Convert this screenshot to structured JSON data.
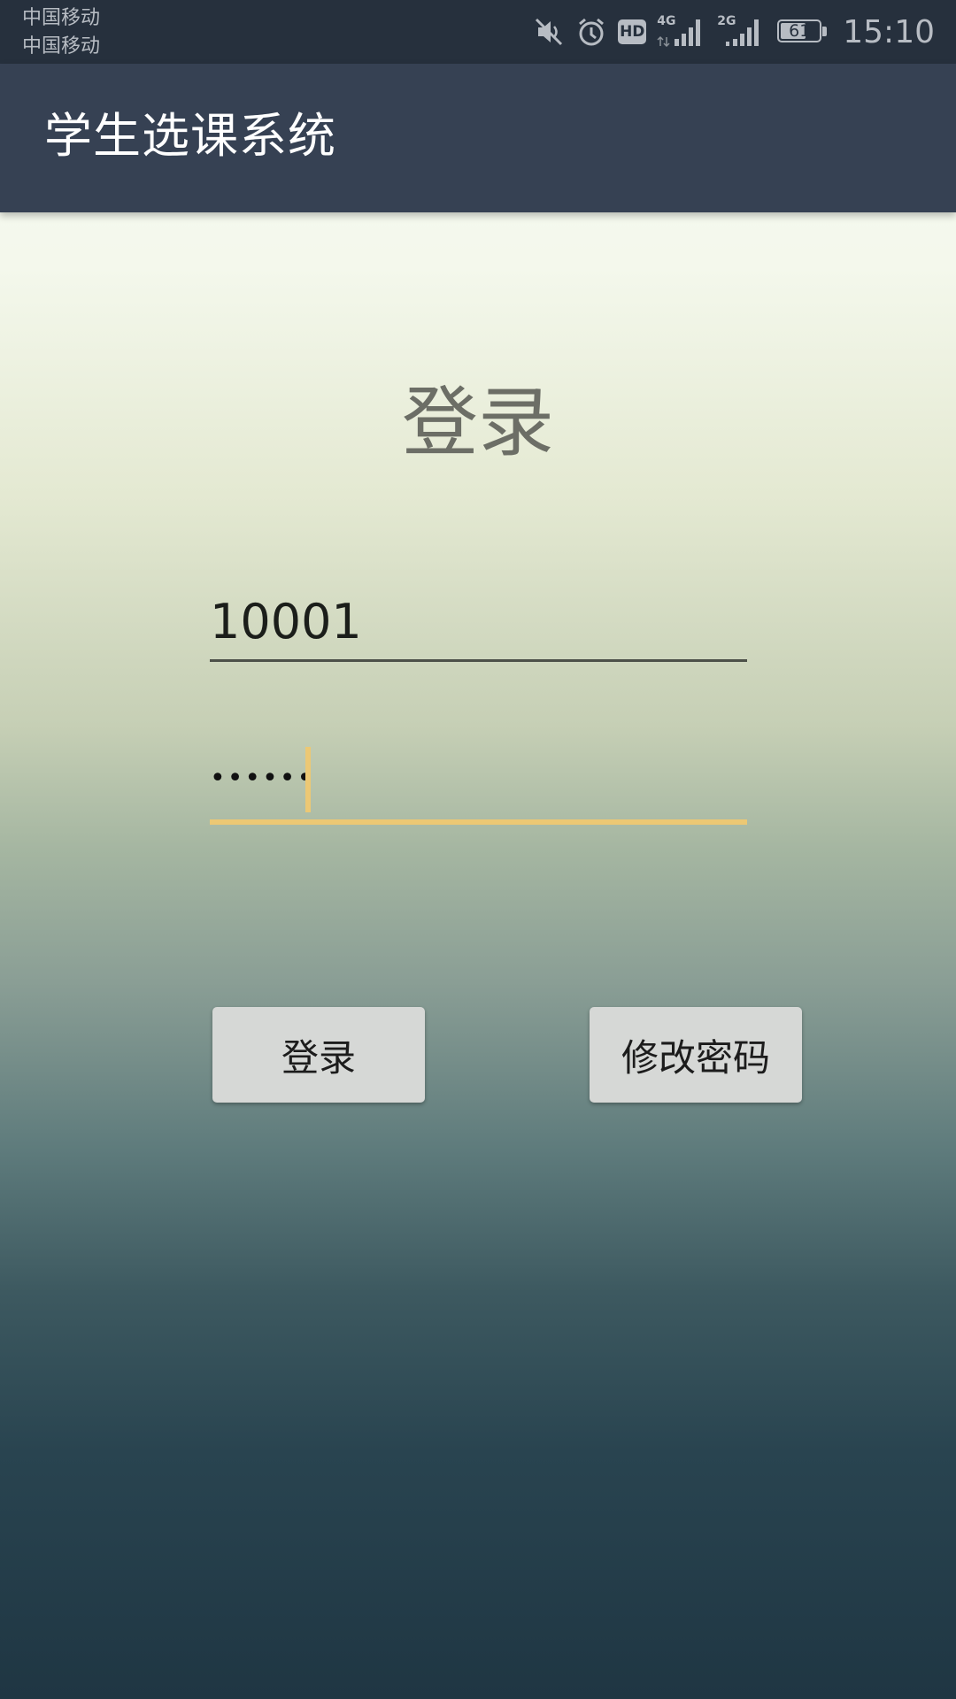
{
  "status_bar": {
    "carriers": [
      "中国移动",
      "中国移动"
    ],
    "icons": [
      "mute-icon",
      "alarm-icon",
      "hd-icon",
      "signal-4g-icon",
      "signal-2g-icon",
      "battery-icon"
    ],
    "hd_label": "HD",
    "network_1": "4G",
    "network_2": "2G",
    "battery_level": "61",
    "time": "15:10"
  },
  "app_bar": {
    "title": "学生选课系统",
    "color": "#364153"
  },
  "login": {
    "heading": "登录",
    "username_value": "10001",
    "password_mask": "••••••",
    "accent_color": "#ecc874"
  },
  "buttons": {
    "login_label": "登录",
    "change_password_label": "修改密码"
  }
}
